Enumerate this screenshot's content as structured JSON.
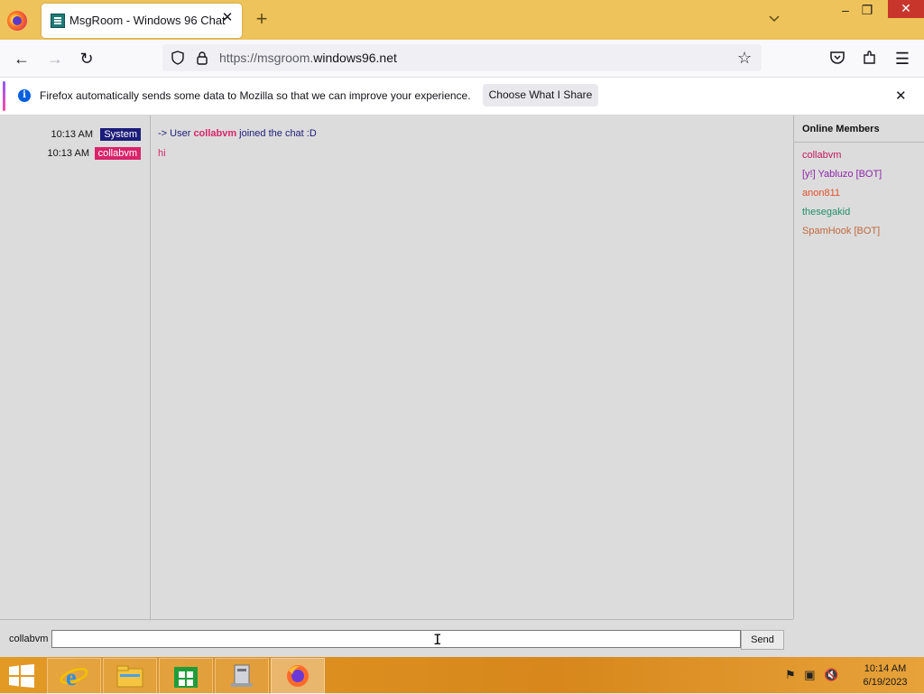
{
  "browser": {
    "tab_title": "MsgRoom - Windows 96 Chat",
    "url_prefix": "https://msgroom.",
    "url_domain": "windows96.net",
    "notification": {
      "message": "Firefox automatically sends some data to Mozilla so that we can improve your experience.",
      "button_label": "Choose What I Share"
    }
  },
  "chat": {
    "messages": [
      {
        "time": "10:13 AM",
        "sender": "System",
        "sender_color": "#1c1c7a",
        "pre": "-> User ",
        "highlight": "collabvm",
        "post": " joined the chat :D",
        "text_color": "#1c1c7a",
        "highlight_color": "#d9246a"
      },
      {
        "time": "10:13 AM",
        "sender": "collabvm",
        "sender_color": "#d9246a",
        "pre": "hi",
        "highlight": "",
        "post": "",
        "text_color": "#d9246a",
        "highlight_color": "#d9246a"
      }
    ],
    "members_title": "Online Members",
    "members": [
      {
        "name": "collabvm",
        "color": "#c2185b"
      },
      {
        "name": "[y!] Yabluzo [BOT]",
        "color": "#8e24aa"
      },
      {
        "name": "anon811",
        "color": "#e0502a"
      },
      {
        "name": "thesegakid",
        "color": "#1f8f6a"
      },
      {
        "name": "SpamHook [BOT]",
        "color": "#c0683a"
      }
    ],
    "nickname": "collabvm",
    "input_value": "",
    "send_label": "Send"
  },
  "taskbar": {
    "time": "10:14 AM",
    "date": "6/19/2023"
  }
}
